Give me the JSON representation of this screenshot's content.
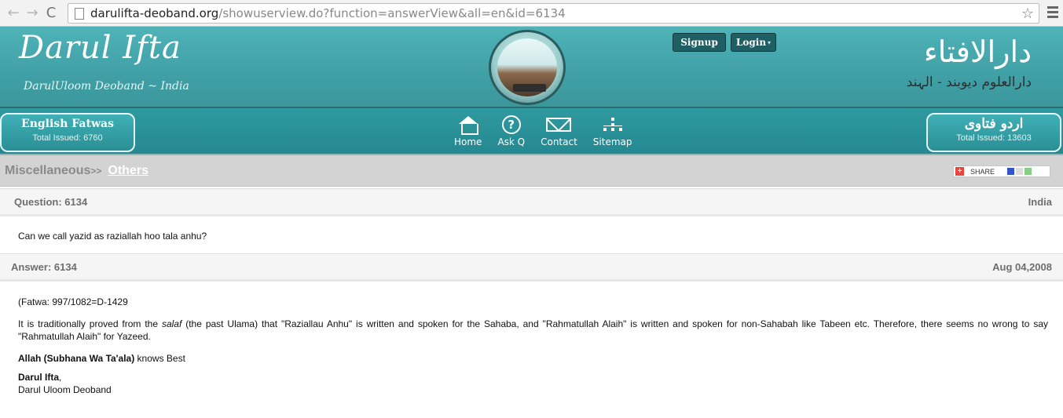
{
  "browser": {
    "back_glyph": "←",
    "forward_glyph": "→",
    "reload_glyph": "C",
    "url_host": "darulifta-deoband.org",
    "url_path": "/showuserview.do?function=answerView&all=en&id=6134",
    "star_glyph": "☆"
  },
  "header": {
    "title": "Darul Ifta",
    "subtitle": "DarulUloom Deoband ~ India",
    "signup_label": "Signup",
    "login_label": "Login",
    "login_caret": "▾",
    "urdu_title": "دارالافتاء",
    "urdu_subtitle": "دارالعلوم دیوبند - الہند"
  },
  "navbar": {
    "english_box": {
      "title": "English Fatwas",
      "count": "Total Issued: 6760"
    },
    "urdu_box": {
      "title": "اردو فتاوی",
      "count": "Total Issued: 13603"
    },
    "items": [
      {
        "label": "Home",
        "icon": "home-icon"
      },
      {
        "label": "Ask Q",
        "icon": "question-icon"
      },
      {
        "label": "Contact",
        "icon": "envelope-icon"
      },
      {
        "label": "Sitemap",
        "icon": "sitemap-icon"
      }
    ],
    "ask_glyph": "?"
  },
  "breadcrumb": {
    "category": "Miscellaneous",
    "separator": ">>",
    "subcategory": "Others"
  },
  "share": {
    "label": "SHARE",
    "plus": "+"
  },
  "question": {
    "label": "Question: 6134",
    "country": "India",
    "text": "Can we call yazid as raziallah hoo tala anhu?"
  },
  "answer": {
    "label": "Answer: 6134",
    "date": "Aug 04,2008",
    "fatwa_ref": "(Fatwa: 997/1082=D-1429",
    "para_prefix": "It is traditionally proved from the ",
    "para_italic": "salaf",
    "para_rest": " (the past Ulama) that \"Raziallau Anhu\" is written and spoken for the Sahaba, and \"Rahmatullah Alaih\" is written and spoken for non-Sahabah like Tabeen etc. Therefore, there seems no wrong to say \"Rahmatullah Alaih\" for Yazeed.",
    "closing_bold": "Allah (Subhana Wa Ta'ala)",
    "closing_rest": " knows Best",
    "sign_bold": "Darul Ifta",
    "sign_comma": ",",
    "sign_line2": "Darul Uloom Deoband"
  },
  "colors": {
    "header_teal": "#4fb3b8",
    "navbar_teal": "#2f9aa0",
    "button_dark": "#1f5f63",
    "crumb_gray": "#d3d3d3"
  }
}
